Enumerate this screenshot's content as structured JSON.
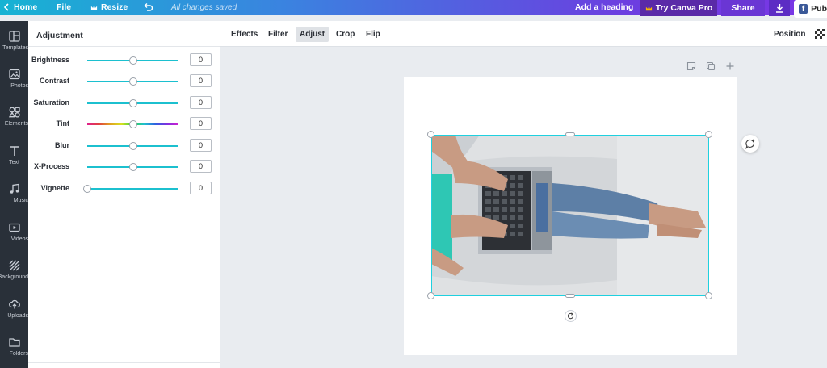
{
  "topbar": {
    "home": "Home",
    "file": "File",
    "resize": "Resize",
    "saved_status": "All changes saved",
    "add_heading": "Add a heading",
    "try_pro": "Try Canva Pro",
    "share": "Share",
    "publish": "Pub"
  },
  "sidebar": {
    "items": [
      {
        "label": "Templates",
        "icon": "templates-icon"
      },
      {
        "label": "Photos",
        "icon": "photos-icon"
      },
      {
        "label": "Elements",
        "icon": "elements-icon"
      },
      {
        "label": "Text",
        "icon": "text-icon"
      },
      {
        "label": "Music",
        "icon": "music-icon"
      },
      {
        "label": "Videos",
        "icon": "videos-icon"
      },
      {
        "label": "Background",
        "icon": "background-icon"
      },
      {
        "label": "Uploads",
        "icon": "uploads-icon"
      },
      {
        "label": "Folders",
        "icon": "folders-icon"
      }
    ]
  },
  "panel": {
    "title": "Adjustment",
    "sliders": [
      {
        "label": "Brightness",
        "value": "0",
        "level": 0.5
      },
      {
        "label": "Contrast",
        "value": "0",
        "level": 0.5
      },
      {
        "label": "Saturation",
        "value": "0",
        "level": 0.5
      },
      {
        "label": "Tint",
        "value": "0",
        "level": 0.5
      },
      {
        "label": "Blur",
        "value": "0",
        "level": 0.5
      },
      {
        "label": "X-Process",
        "value": "0",
        "level": 0.5
      },
      {
        "label": "Vignette",
        "value": "0",
        "level": 0
      }
    ]
  },
  "toolbar": {
    "effects": "Effects",
    "filter": "Filter",
    "adjust": "Adjust",
    "crop": "Crop",
    "flip": "Flip",
    "position": "Position",
    "active_tool": "Adjust"
  },
  "colors": {
    "selection": "#1fd0df",
    "slider_fill": "#1cc0cf",
    "try_pro_bg": "#5a2aa8"
  }
}
